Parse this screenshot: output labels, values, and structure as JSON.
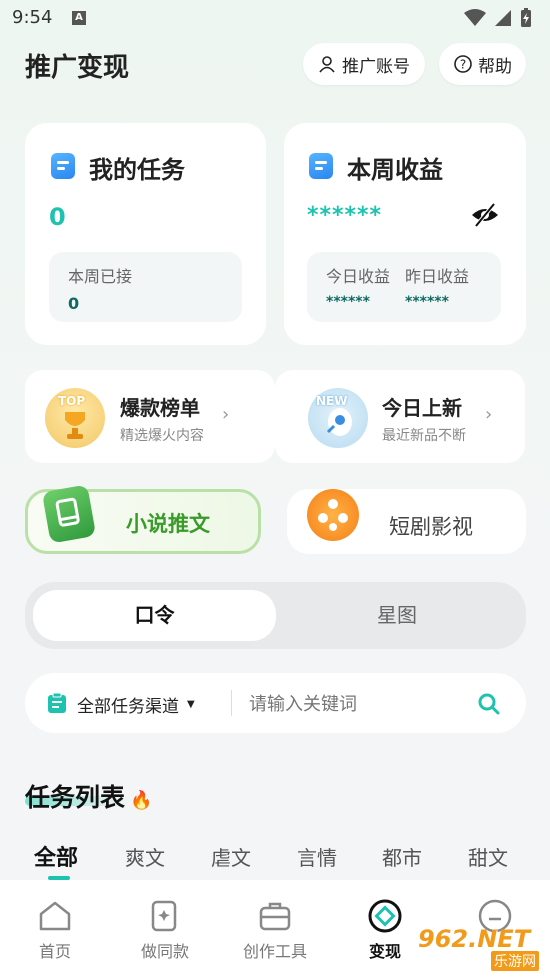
{
  "status_bar": {
    "time": "9:54",
    "notif_icon": "A"
  },
  "header": {
    "title": "推广变现",
    "account_btn": "推广账号",
    "help_btn": "帮助"
  },
  "my_tasks": {
    "title": "我的任务",
    "count": "0",
    "week_label": "本周已接",
    "week_value": "0"
  },
  "week_income": {
    "title": "本周收益",
    "masked": "******",
    "today_label": "今日收益",
    "yesterday_label": "昨日收益",
    "today_value": "******",
    "yesterday_value": "******"
  },
  "shortcuts": [
    {
      "title": "爆款榜单",
      "subtitle": "精选爆火内容",
      "badge": "TOP"
    },
    {
      "title": "今日上新",
      "subtitle": "最近新品不断",
      "badge": "NEW"
    }
  ],
  "categories": {
    "novel": "小说推文",
    "drama": "短剧影视"
  },
  "segment": {
    "left": "口令",
    "right": "星图"
  },
  "search": {
    "channel": "全部任务渠道",
    "placeholder": "请输入关键词"
  },
  "task_list": {
    "title": "任务列表",
    "tabs": [
      "全部",
      "爽文",
      "虐文",
      "言情",
      "都市",
      "甜文"
    ]
  },
  "nav": {
    "items": [
      "首页",
      "做同款",
      "创作工具",
      "变现",
      ""
    ]
  },
  "watermark": {
    "brand": "962.NET",
    "sub": "乐游网"
  },
  "colors": {
    "accent": "#1ec3b0",
    "novel_green": "#3aa24a"
  }
}
